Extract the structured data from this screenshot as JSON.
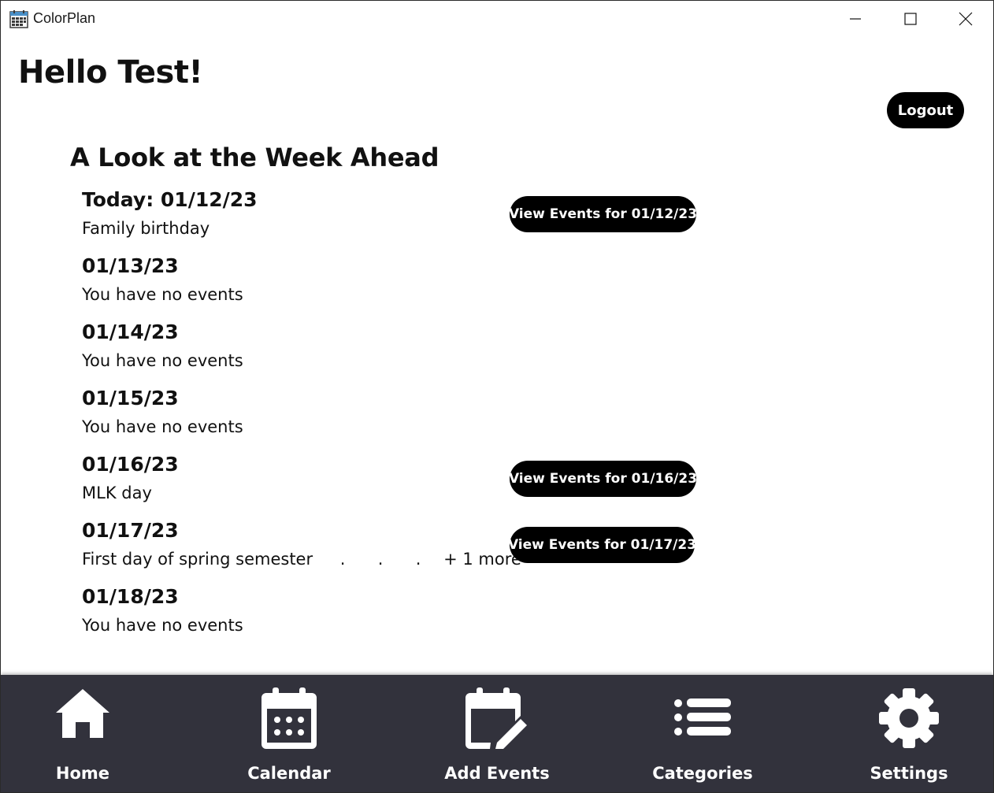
{
  "window": {
    "title": "ColorPlan",
    "icon": "calendar-app-icon",
    "controls": [
      "minimize-icon",
      "maximize-icon",
      "close-icon"
    ]
  },
  "greeting": "Hello Test!",
  "logout_label": "Logout",
  "section_title": "A Look at the Week Ahead",
  "days": [
    {
      "date": "Today: 01/12/23",
      "event": "Family birthday",
      "button": "View Events for 01/12/23"
    },
    {
      "date": "01/13/23",
      "event": "You have no events"
    },
    {
      "date": "01/14/23",
      "event": "You have no events"
    },
    {
      "date": "01/15/23",
      "event": "You have no events"
    },
    {
      "date": "01/16/23",
      "event": "MLK day",
      "button": "View Events for 01/16/23"
    },
    {
      "date": "01/17/23",
      "event": "First day of spring semester",
      "dots": ".",
      "more": "+ 1 more",
      "button": "View Events for 01/17/23"
    },
    {
      "date": "01/18/23",
      "event": "You have no events"
    }
  ],
  "nav": {
    "background": "#32323c",
    "items": [
      {
        "label": "Home",
        "icon": "home-icon"
      },
      {
        "label": "Calendar",
        "icon": "calendar-icon"
      },
      {
        "label": "Add Events",
        "icon": "calendar-edit-icon"
      },
      {
        "label": "Categories",
        "icon": "list-icon"
      },
      {
        "label": "Settings",
        "icon": "gear-icon"
      }
    ]
  }
}
